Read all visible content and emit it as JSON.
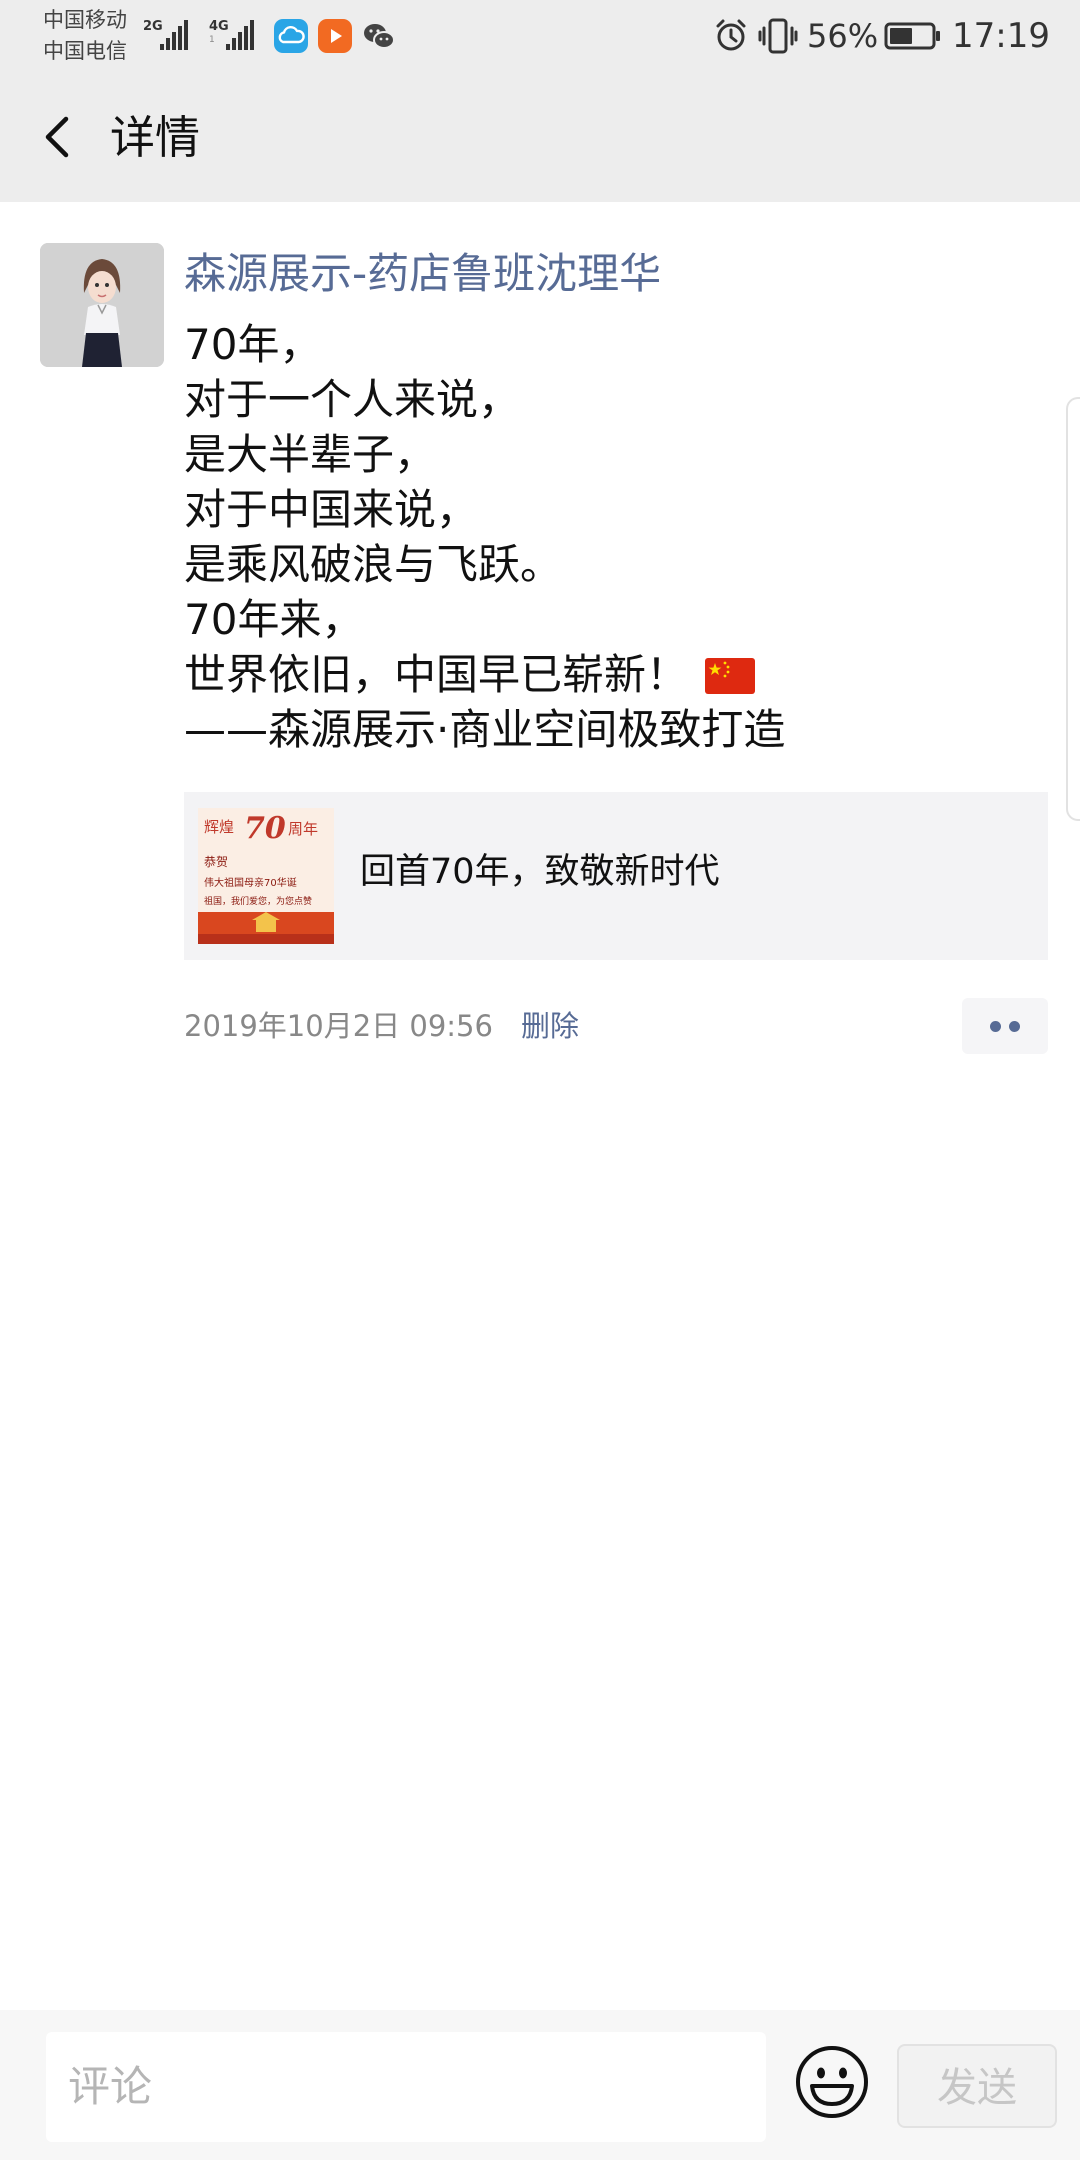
{
  "status_bar": {
    "carrier_1": "中国移动",
    "carrier_2": "中国电信",
    "signal_1_tag": "2G",
    "signal_2_tag": "4G",
    "signal_2_sub": "1",
    "battery_percent": "56%",
    "battery_level": 0.56,
    "time": "17:19",
    "icons": [
      "cloud-icon",
      "video-icon",
      "wechat-icon",
      "alarm-icon",
      "vibrate-icon",
      "battery-icon"
    ],
    "colors": {
      "cloud": "#2aa5e6",
      "video": "#f26a22"
    }
  },
  "title_bar": {
    "title": "详情",
    "back_icon": "chevron-left-icon"
  },
  "post": {
    "author": "森源展示-药店鲁班沈理华",
    "lines": [
      "70年，",
      "对于一个人来说，",
      "是大半辈子，",
      "对于中国来说，",
      "是乘风破浪与飞跃。",
      "70年来，",
      "世界依旧，中国早已崭新！",
      "——森源展示·商业空间极致打造"
    ],
    "flag_icon": "china-flag-icon",
    "link_card": {
      "title": "回首70年，致敬新时代",
      "thumb_text_top": "辉煌",
      "thumb_number": "70",
      "thumb_text_year": "周年",
      "thumb_line_1": "恭贺",
      "thumb_line_2": "伟大祖国母亲70华诞",
      "thumb_line_3": "祖国，我们爱您，为您点赞"
    },
    "timestamp": "2019年10月2日 09:56",
    "delete_label": "删除",
    "link_color": "#576b95"
  },
  "comment_bar": {
    "placeholder": "评论",
    "send_label": "发送",
    "emoji_icon": "smiley-face-icon"
  }
}
